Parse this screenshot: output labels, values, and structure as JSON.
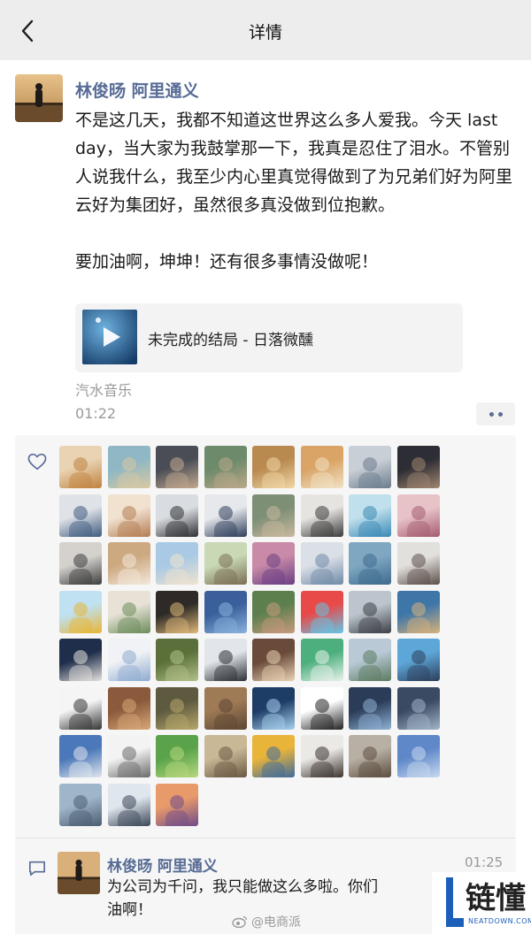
{
  "nav": {
    "title": "详情",
    "back_icon": "chevron-left-icon"
  },
  "post": {
    "author": "林俊旸 阿里通义",
    "text": "不是这几天，我都不知道这世界这么多人爱我。今天 last day，当大家为我鼓掌那一下，我真是忍住了泪水。不管别人说我什么，我至少内心里真觉得做到了为兄弟们好为阿里云好为集团好，虽然很多真没做到位抱歉。\n\n要加油啊，坤坤！还有很多事情没做呢！",
    "music": {
      "title": "未完成的结局 - 日落微醺",
      "play_icon": "play-icon"
    },
    "source": "汽水音乐",
    "time": "01:22",
    "more_icon": "more-dots-icon"
  },
  "likes": {
    "icon": "heart-icon",
    "avatar_count": 59,
    "avatar_colors": [
      [
        "#e9d3b2",
        "#c0823f"
      ],
      [
        "#8fb7c4",
        "#d9c9a1"
      ],
      [
        "#4a4d56",
        "#c3a98f"
      ],
      [
        "#6d8a6a",
        "#bba88a"
      ],
      [
        "#b98a4f",
        "#f0d7a6"
      ],
      [
        "#d9a465",
        "#f1e2c5"
      ],
      [
        "#c9cfd6",
        "#6b7c8c"
      ],
      [
        "#2d2d35",
        "#a08670"
      ],
      [
        "#dfe3e8",
        "#3e5a7e"
      ],
      [
        "#f1e1cf",
        "#b37d52"
      ],
      [
        "#d9dde2",
        "#2f2f33"
      ],
      [
        "#e6e8ec",
        "#2d3e5a"
      ],
      [
        "#7d8f75",
        "#c9b8a0"
      ],
      [
        "#e6e4e1",
        "#3a3a3a"
      ],
      [
        "#bfe0ec",
        "#3a88b5"
      ],
      [
        "#e7c3c8",
        "#a55b6f"
      ],
      [
        "#d5d2ce",
        "#3c3c3c"
      ],
      [
        "#cda981",
        "#f3e9dc"
      ],
      [
        "#a9c9e4",
        "#f0e3cf"
      ],
      [
        "#c9d9b6",
        "#7a6d55"
      ],
      [
        "#c88aa7",
        "#6b3f84"
      ],
      [
        "#dbe0e7",
        "#6f89a7"
      ],
      [
        "#7fa7c2",
        "#3e6a8c"
      ],
      [
        "#e2e0dd",
        "#5b4f49"
      ],
      [
        "#bfe1f1",
        "#e8b634"
      ],
      [
        "#e7e2d5",
        "#6a8c5b"
      ],
      [
        "#2d2a27",
        "#e0b979"
      ],
      [
        "#3b5f9a",
        "#8ab2de"
      ],
      [
        "#5d7f4e",
        "#c89a7c"
      ],
      [
        "#e84a4a",
        "#62c7e8"
      ],
      [
        "#bcc5cd",
        "#3b3f44"
      ],
      [
        "#3e76a8",
        "#d8b27a"
      ],
      [
        "#1f2e4a",
        "#e6e3df"
      ],
      [
        "#f0f2f5",
        "#8eaad0"
      ],
      [
        "#5a6f3a",
        "#b3c28a"
      ],
      [
        "#e2e6ea",
        "#2c2f35"
      ],
      [
        "#6a4a3a",
        "#e9d3b4"
      ],
      [
        "#4caf7d",
        "#e8f2ea"
      ],
      [
        "#b9c9d6",
        "#5a7a5f"
      ],
      [
        "#5da7d8",
        "#2c3e5a"
      ],
      [
        "#f5f5f5",
        "#333333"
      ],
      [
        "#8b5a3c",
        "#d9a877"
      ],
      [
        "#5e5a40",
        "#b8a86b"
      ],
      [
        "#9e7a55",
        "#5d4634"
      ],
      [
        "#1d3d66",
        "#a9d2f0"
      ],
      [
        "#ffffff",
        "#222222"
      ],
      [
        "#2b3c58",
        "#8fb2d4"
      ],
      [
        "#3b4a63",
        "#a2b5c8"
      ],
      [
        "#4b78b8",
        "#e1e6ee"
      ],
      [
        "#f3f3f3",
        "#6a6a6a"
      ],
      [
        "#5aa34a",
        "#b8d87e"
      ],
      [
        "#c9b896",
        "#6a5943"
      ],
      [
        "#e8b43a",
        "#3f6b9e"
      ],
      [
        "#ebe9e6",
        "#3c332f"
      ],
      [
        "#b8b0a4",
        "#5c4d3f"
      ],
      [
        "#5f88c9",
        "#c8d9ee"
      ],
      [
        "#9fb5c9",
        "#4a5c70"
      ],
      [
        "#dfe6ee",
        "#3b4656"
      ],
      [
        "#e89a6a",
        "#6f4b8a"
      ]
    ]
  },
  "comment": {
    "icon": "comment-icon",
    "author": "林俊旸 阿里通义",
    "time": "01:25",
    "text": "为公司为千问，我只能做这么多啦。你们\n油啊！"
  },
  "watermark": {
    "text": "@电商派",
    "icon": "weibo-icon"
  },
  "site_logo": {
    "text": "链懂",
    "sub": "NEATDOWN.COM",
    "colors": {
      "mark": "#1d5fb8"
    }
  }
}
